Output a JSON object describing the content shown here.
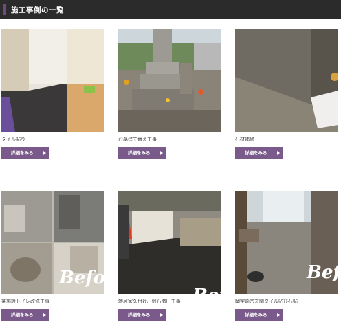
{
  "section_title": "施工事例の一覧",
  "cards": [
    {
      "caption": "タイル貼り",
      "button": "詳細をみる"
    },
    {
      "caption": "お墓建て替え工事",
      "button": "詳細をみる"
    },
    {
      "caption": "石材補修",
      "button": "詳細をみる"
    },
    {
      "caption": "某施設トイレ改修工事",
      "button": "詳細をみる"
    },
    {
      "caption": "雑居家久付け、敷石撤旧工事",
      "button": "詳細をみる"
    },
    {
      "caption": "岡宇崎宗玄関タイル貼び石貼",
      "button": "詳細をみる"
    }
  ],
  "overlays": {
    "card4_text": "Before",
    "card5_text": "Befo",
    "card6_text": "Befo"
  },
  "colors": {
    "accent": "#7a5a8a",
    "header_bg": "#2b2b2b"
  }
}
